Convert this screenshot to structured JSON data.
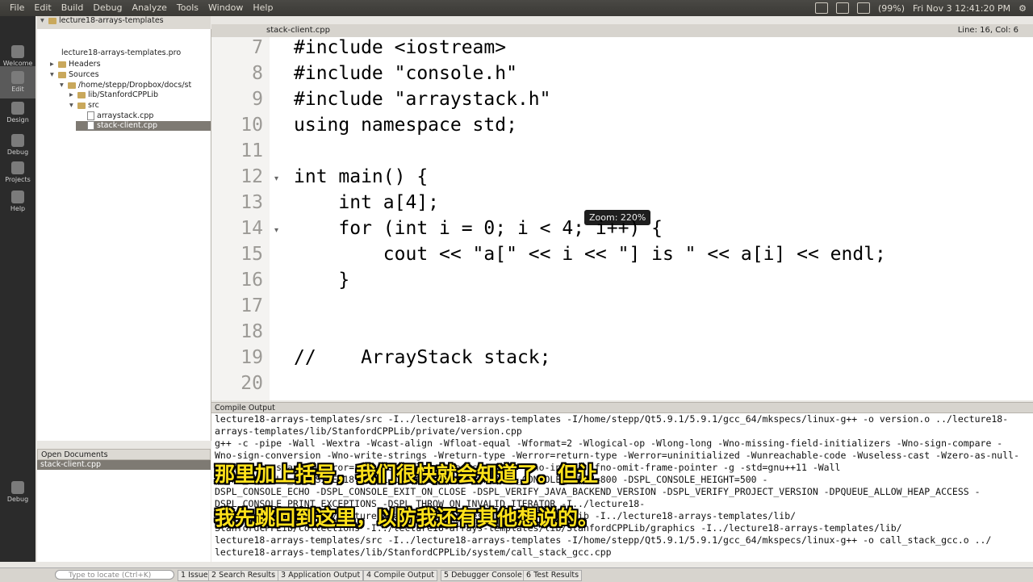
{
  "menubar": {
    "items": [
      "File",
      "Edit",
      "Build",
      "Debug",
      "Analyze",
      "Tools",
      "Window",
      "Help"
    ]
  },
  "tray": {
    "battery": "(99%)",
    "datetime": "Fri Nov 3  12:41:20 PM"
  },
  "modes": [
    "Welcome",
    "Edit",
    "Design",
    "Debug",
    "Projects",
    "Help"
  ],
  "project_tree": {
    "root": "lecture18-arrays-templates",
    "pro_file": "lecture18-arrays-templates.pro",
    "headers": "Headers",
    "sources": "Sources",
    "path": "/home/stepp/Dropbox/docs/st",
    "lib": "lib/StanfordCPPLib",
    "src": "src",
    "files": [
      "arraystack.cpp",
      "stack-client.cpp"
    ]
  },
  "open_documents": {
    "title": "Open Documents",
    "items": [
      "stack-client.cpp"
    ]
  },
  "editor": {
    "filename": "stack-client.cpp",
    "position": "Line: 16, Col: 6",
    "zoom": "Zoom: 220%"
  },
  "code_lines": [
    {
      "n": "7",
      "text": "#include <iostream>"
    },
    {
      "n": "8",
      "text": "#include \"console.h\""
    },
    {
      "n": "9",
      "text": "#include \"arraystack.h\""
    },
    {
      "n": "10",
      "text": "using namespace std;"
    },
    {
      "n": "11",
      "text": ""
    },
    {
      "n": "12",
      "text": "int main() {"
    },
    {
      "n": "13",
      "text": "    int a[4];"
    },
    {
      "n": "14",
      "text": "    for (int i = 0; i < 4; i++) {"
    },
    {
      "n": "15",
      "text": "        cout << \"a[\" << i << \"] is \" << a[i] << endl;"
    },
    {
      "n": "16",
      "text": "    }"
    },
    {
      "n": "17",
      "text": ""
    },
    {
      "n": "18",
      "text": ""
    },
    {
      "n": "19",
      "text": "//    ArrayStack stack;"
    },
    {
      "n": "20",
      "text": ""
    }
  ],
  "compile_output": {
    "title": "Compile Output",
    "lines": [
      "lecture18-arrays-templates/src -I../lecture18-arrays-templates -I/home/stepp/Qt5.9.1/5.9.1/gcc_64/mkspecs/linux-g++ -o version.o ../lecture18-",
      "arrays-templates/lib/StanfordCPPLib/private/version.cpp",
      "g++ -c -pipe -Wall -Wextra -Wcast-align -Wfloat-equal -Wformat=2 -Wlogical-op -Wlong-long -Wno-missing-field-initializers -Wno-sign-compare -",
      "Wno-sign-conversion -Wno-write-strings -Wreturn-type -Werror=return-type -Werror=uninitialized -Wunreachable-code -Wuseless-cast -Wzero-as-null-",
      "pointer-constant -Werror=zero-as-null-pointer-constant -Wno-inline -fno-omit-frame-pointer -g -std=gnu++11 -Wall",
      "-DSPL_CONSOLE_FONTSIZE=18 -DSPL_CONSOLE_X=171024 -DSPL_CONSOLE_WIDTH=800 -DSPL_CONSOLE_HEIGHT=500 -",
      "DSPL_CONSOLE_ECHO -DSPL_CONSOLE_EXIT_ON_CLOSE -DSPL_VERIFY_JAVA_BACKEND_VERSION -DSPL_VERIFY_PROJECT_VERSION -DPQUEUE_ALLOW_HEAP_ACCESS -",
      "DSPL_CONSOLE_PRINT_EXCEPTIONS -DSPL_THROW_ON_INVALID_ITERATOR -I../lecture18-",
      "arrays-templates -I../lecture18-arrays-templates/lib/StanfordCPPLib -I../lecture18-arrays-templates/lib/",
      "StanfordCPPLib/collections -I../lecture18-arrays-templates/lib/StanfordCPPLib/graphics -I../lecture18-arrays-templates/lib/",
      "lecture18-arrays-templates/src -I../lecture18-arrays-templates -I/home/stepp/Qt5.9.1/5.9.1/gcc_64/mkspecs/linux-g++ -o call_stack_gcc.o ../",
      "lecture18-arrays-templates/lib/StanfordCPPLib/system/call_stack_gcc.cpp"
    ]
  },
  "subtitles": [
    "那里加上括号，我们很快就会知道了。但让",
    "我先跳回到这里，以防我还有其他想说的。"
  ],
  "statusbar": {
    "locate_placeholder": "Type to locate (Ctrl+K)",
    "tabs": [
      "1 Issues",
      "2 Search Results",
      "3 Application Output",
      "4 Compile Output",
      "5 Debugger Console",
      "6 Test Results"
    ]
  },
  "colors": {
    "keyword": "#808000",
    "string": "#008000",
    "subtitle": "#ffe21a"
  }
}
